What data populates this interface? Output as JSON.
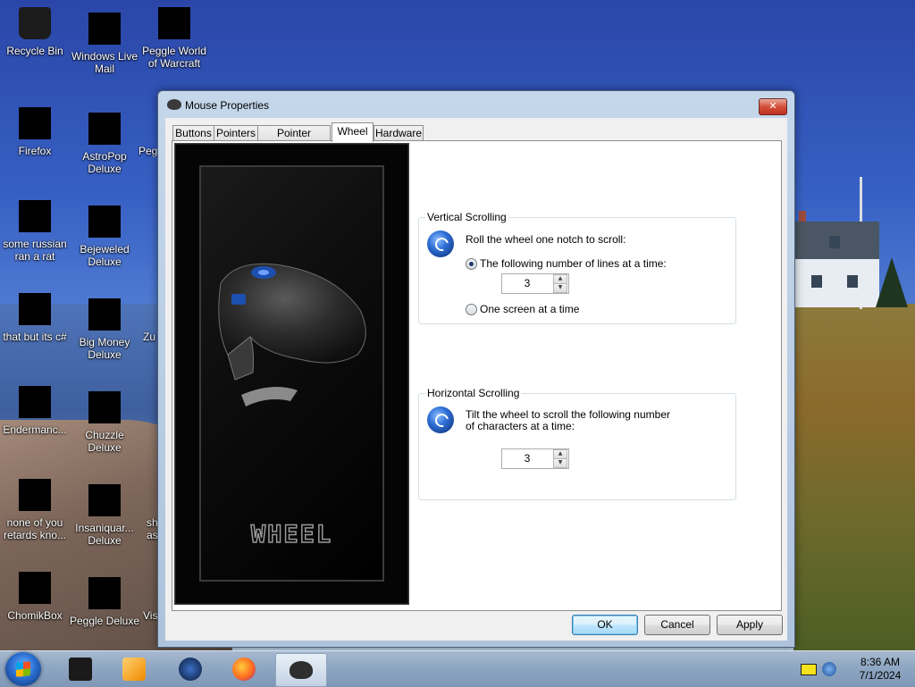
{
  "desktop": {
    "icons": [
      {
        "label": "Recycle Bin"
      },
      {
        "label": "Windows Live\nMail"
      },
      {
        "label": "Peggle World\nof Warcraft"
      },
      {
        "label": "Firefox"
      },
      {
        "label": "AstroPop\nDeluxe"
      },
      {
        "label": "Peg"
      },
      {
        "label": "some russian\nran a rat"
      },
      {
        "label": "Bejeweled\nDeluxe"
      },
      {
        "label": "that but its c#"
      },
      {
        "label": "Big Money\nDeluxe"
      },
      {
        "label": "Zu"
      },
      {
        "label": "Endermanc..."
      },
      {
        "label": "Chuzzle\nDeluxe"
      },
      {
        "label": "none of you\nretards kno..."
      },
      {
        "label": "Insaniquar...\nDeluxe"
      },
      {
        "label": "sh\nas"
      },
      {
        "label": "ChomikBox"
      },
      {
        "label": "Peggle Deluxe"
      },
      {
        "label": "Vis"
      }
    ]
  },
  "window": {
    "title": "Mouse Properties",
    "close_label": "✕",
    "tabs": [
      {
        "label": "Buttons",
        "active": false
      },
      {
        "label": "Pointers",
        "active": false
      },
      {
        "label": "Pointer Options",
        "active": false
      },
      {
        "label": "Wheel",
        "active": true
      },
      {
        "label": "Hardware",
        "active": false
      }
    ],
    "promo_text": "WHEEL",
    "vertical": {
      "label": "Vertical Scrolling",
      "description": "Roll the wheel one notch to scroll:",
      "option_lines": "The following number of lines at a time:",
      "lines_value": "3",
      "option_screen": "One screen at a time",
      "selected": "lines"
    },
    "horizontal": {
      "label": "Horizontal Scrolling",
      "description_line1": "Tilt the wheel to scroll the following number",
      "description_line2": "of characters at a time:",
      "chars_value": "3"
    },
    "buttons": {
      "ok": "OK",
      "cancel": "Cancel",
      "apply": "Apply"
    }
  },
  "taskbar": {
    "items": [
      "start-button",
      "app-1",
      "media-player",
      "mouse-software",
      "firefox",
      "mouse-properties"
    ],
    "clock_time": "8:36 AM",
    "clock_date": "7/1/2024"
  },
  "colors": {
    "accent": "#3c7fb1",
    "close_red": "#c2301f"
  }
}
